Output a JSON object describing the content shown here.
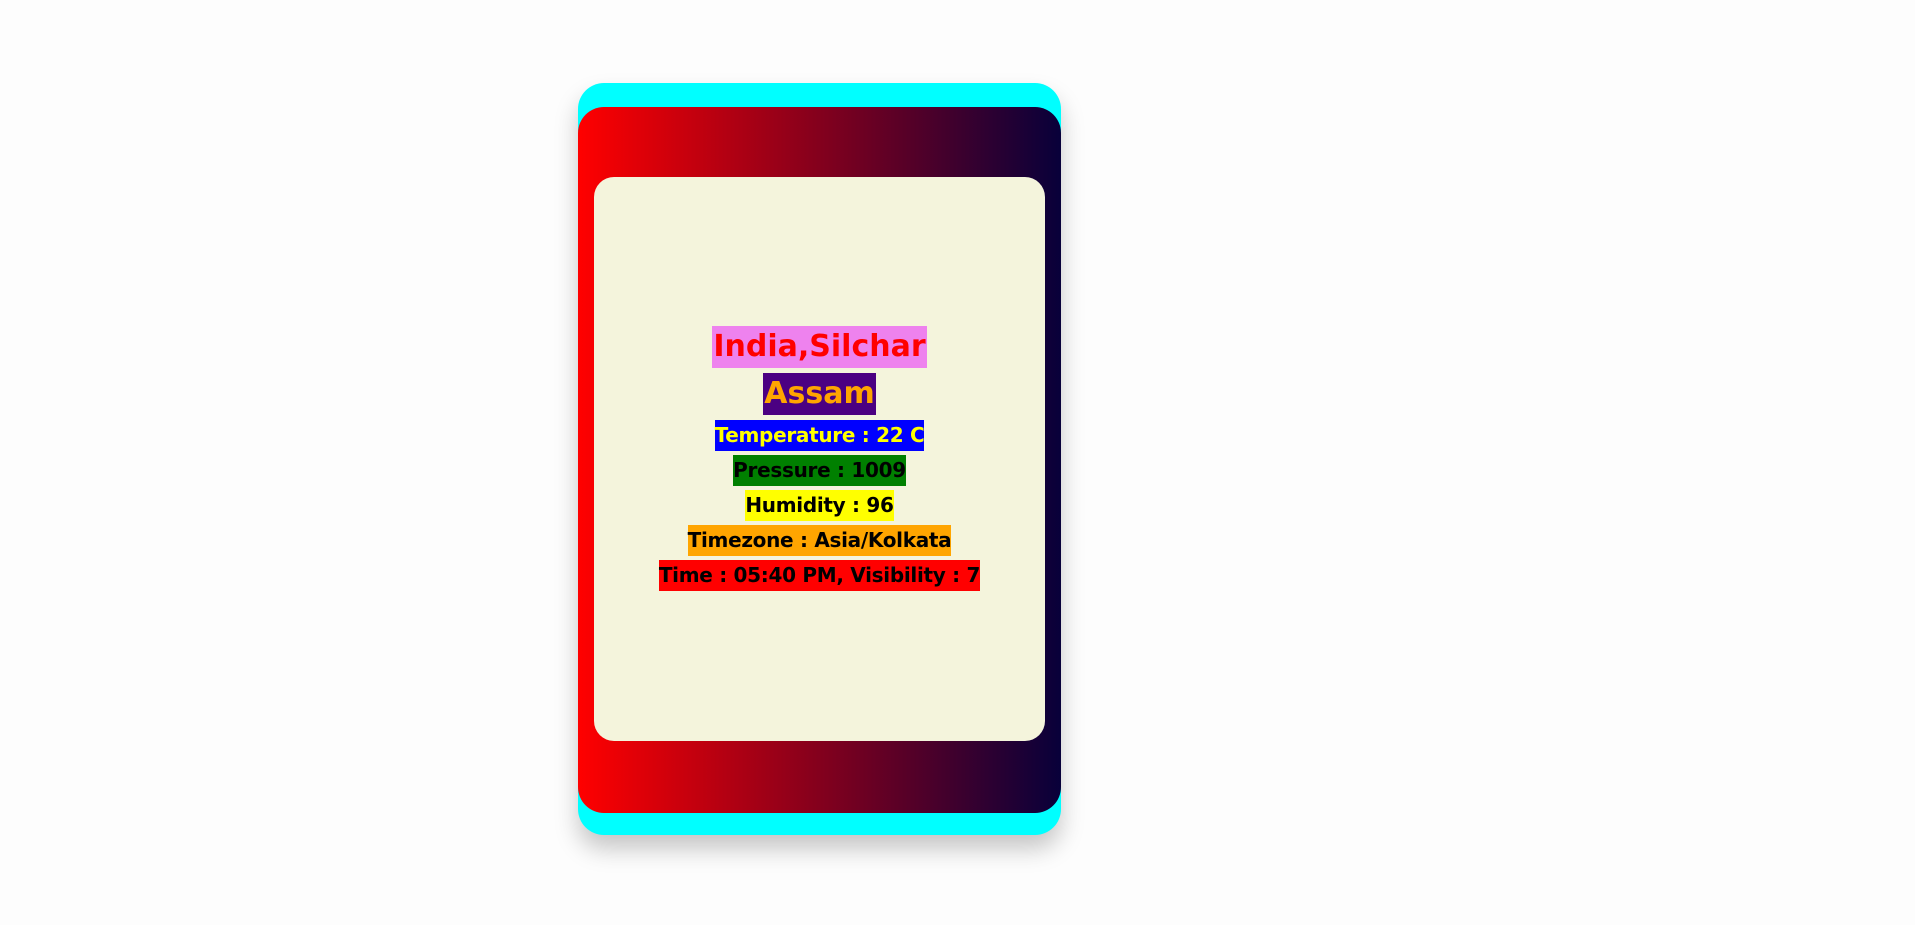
{
  "card": {
    "location": "India,Silchar",
    "region": "Assam",
    "temperature": "Temperature : 22 C",
    "pressure": "Pressure : 1009",
    "humidity": "Humidity : 96",
    "timezone": "Timezone : Asia/Kolkata",
    "time_visibility": "Time : 05:40 PM, Visibility : 7"
  },
  "colors": {
    "outer_border": "#00ffff",
    "gradient_start": "#ff0000",
    "gradient_end": "#08003a",
    "panel_bg": "#f4f4dc"
  }
}
